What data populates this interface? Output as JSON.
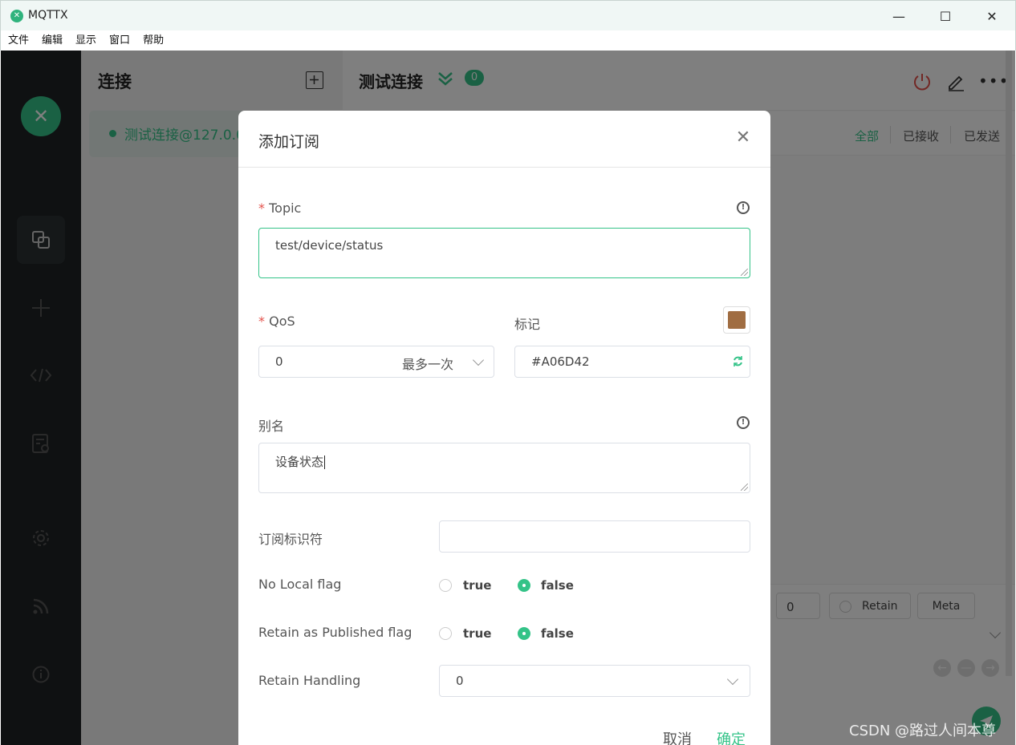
{
  "window": {
    "title": "MQTTX",
    "logo_glyph": "✕",
    "minimize": "—",
    "maximize": "☐",
    "close": "✕"
  },
  "menu": [
    "文件",
    "编辑",
    "显示",
    "窗口",
    "帮助"
  ],
  "leftnav": {
    "logo_glyph": "✕",
    "items": [
      "connections-icon",
      "add-icon",
      "script-icon",
      "log-icon",
      "settings-icon",
      "feed-icon",
      "info-icon"
    ]
  },
  "connections": {
    "title": "连接",
    "items": [
      {
        "name": "测试连接@127.0.0",
        "status_color": "#34c388"
      }
    ]
  },
  "main": {
    "title": "测试连接",
    "badge": "0",
    "filters": [
      "全部",
      "已接收",
      "已发送"
    ],
    "publish": {
      "qos": "0",
      "retain": "Retain",
      "meta": "Meta"
    }
  },
  "dialog": {
    "title": "添加订阅",
    "topic": {
      "label": "Topic",
      "value": "test/device/status"
    },
    "qos": {
      "label": "QoS",
      "value": "0",
      "desc": "最多一次"
    },
    "color": {
      "label": "标记",
      "value": "#A06D42"
    },
    "alias": {
      "label": "别名",
      "value": "设备状态"
    },
    "sub_id": {
      "label": "订阅标识符",
      "value": ""
    },
    "no_local": {
      "label": "No Local flag",
      "true_label": "true",
      "false_label": "false",
      "selected": "false"
    },
    "rap": {
      "label": "Retain as Published flag",
      "true_label": "true",
      "false_label": "false",
      "selected": "false"
    },
    "retain_handling": {
      "label": "Retain Handling",
      "value": "0"
    },
    "cancel": "取消",
    "confirm": "确定"
  },
  "watermark": "CSDN @路过人间本尊",
  "colors": {
    "accent": "#34c388",
    "danger": "#e4504a",
    "tag": "#A06D42"
  }
}
